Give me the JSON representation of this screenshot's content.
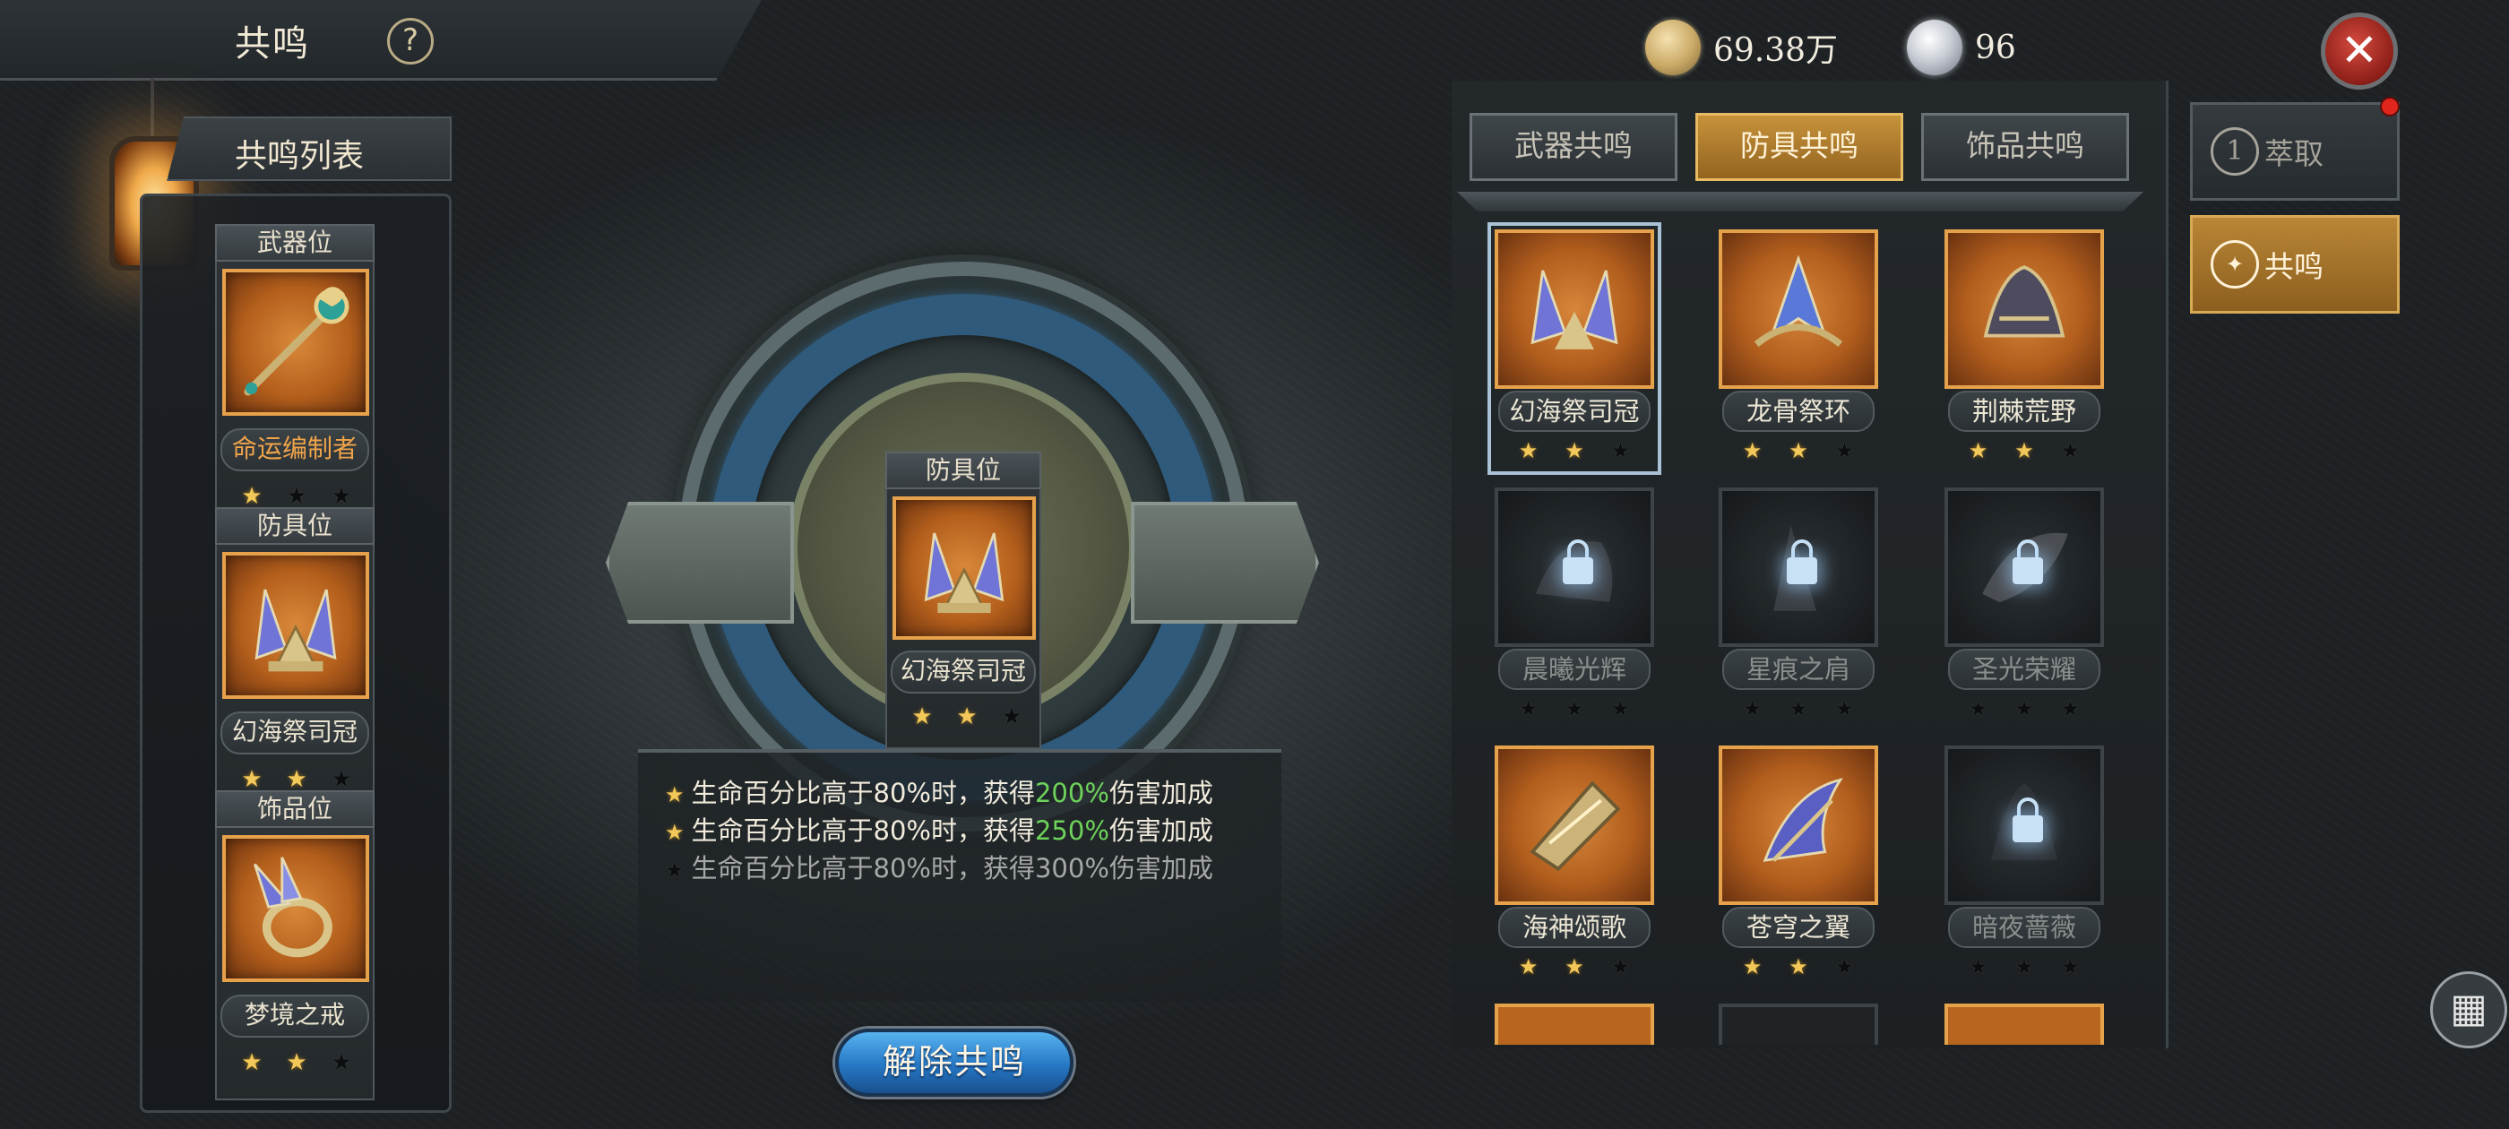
{
  "header": {
    "title": "共鸣",
    "help": "?"
  },
  "currency": {
    "gold_value": "69.38万",
    "gem_value": "96"
  },
  "left_list": {
    "title": "共鸣列表",
    "slots": [
      {
        "label": "武器位",
        "item": "命运编制者",
        "stars": [
          true,
          false,
          false
        ]
      },
      {
        "label": "防具位",
        "item": "幻海祭司冠",
        "stars": [
          true,
          true,
          false
        ]
      },
      {
        "label": "饰品位",
        "item": "梦境之戒",
        "stars": [
          true,
          true,
          false
        ]
      }
    ]
  },
  "center": {
    "slot_label": "防具位",
    "item": "幻海祭司冠",
    "stars": [
      true,
      true,
      false
    ],
    "effects": [
      {
        "pre": "生命百分比高于80%时，获得",
        "pct": "200%",
        "post": "伤害加成",
        "active": true
      },
      {
        "pre": "生命百分比高于80%时，获得",
        "pct": "250%",
        "post": "伤害加成",
        "active": true
      },
      {
        "pre": "生命百分比高于80%时，获得",
        "pct": "300%",
        "post": "伤害加成",
        "active": false
      }
    ],
    "release_button": "解除共鸣"
  },
  "tabs": [
    {
      "label": "武器共鸣",
      "active": false
    },
    {
      "label": "防具共鸣",
      "active": true
    },
    {
      "label": "饰品共鸣",
      "active": false
    }
  ],
  "grid": [
    {
      "name": "幻海祭司冠",
      "locked": false,
      "selected": true,
      "stars": [
        true,
        true,
        false
      ]
    },
    {
      "name": "龙骨祭环",
      "locked": false,
      "selected": false,
      "stars": [
        true,
        true,
        false
      ]
    },
    {
      "name": "荆棘荒野",
      "locked": false,
      "selected": false,
      "stars": [
        true,
        true,
        false
      ]
    },
    {
      "name": "晨曦光辉",
      "locked": true,
      "selected": false,
      "stars": [
        false,
        false,
        false
      ]
    },
    {
      "name": "星痕之肩",
      "locked": true,
      "selected": false,
      "stars": [
        false,
        false,
        false
      ]
    },
    {
      "name": "圣光荣耀",
      "locked": true,
      "selected": false,
      "stars": [
        false,
        false,
        false
      ]
    },
    {
      "name": "海神颂歌",
      "locked": false,
      "selected": false,
      "stars": [
        true,
        true,
        false
      ]
    },
    {
      "name": "苍穹之翼",
      "locked": false,
      "selected": false,
      "stars": [
        true,
        true,
        false
      ]
    },
    {
      "name": "暗夜蔷薇",
      "locked": true,
      "selected": false,
      "stars": [
        false,
        false,
        false
      ]
    }
  ],
  "side": {
    "extract_label": "萃取",
    "extract_icon_text": "1",
    "resonance_label": "共鸣",
    "close": "✕",
    "menu": "▦"
  },
  "colors": {
    "accent_orange": "#e5a24b",
    "highlight_green": "#6ed35a",
    "button_blue": "#2677c4"
  }
}
